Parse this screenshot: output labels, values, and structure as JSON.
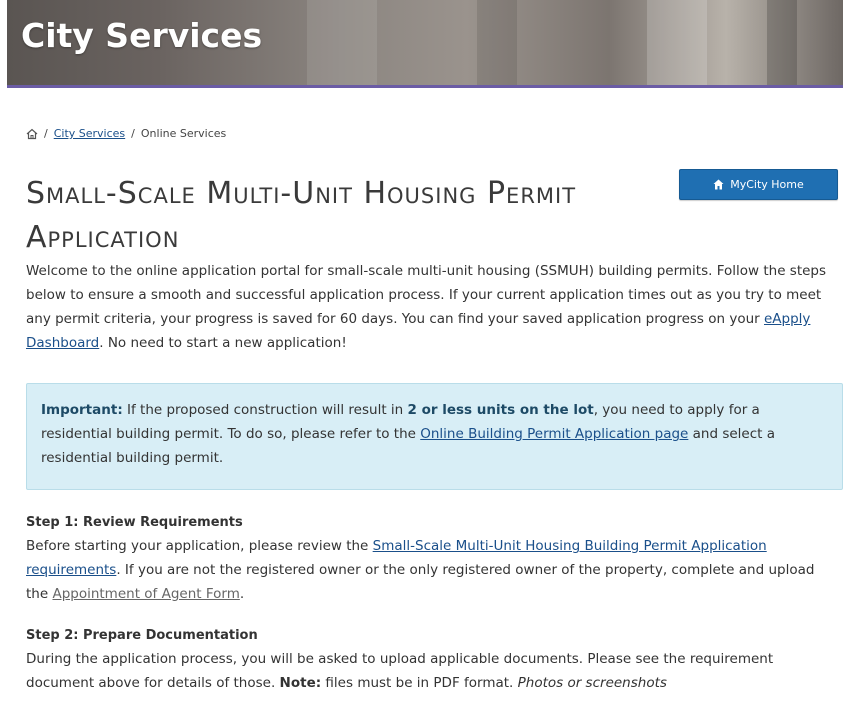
{
  "banner": {
    "title": "City Services"
  },
  "breadcrumb": {
    "crumb1": "City Services",
    "current": "Online Services",
    "sep": "/"
  },
  "header": {
    "title": "Small-Scale Multi-Unit Housing Permit Application",
    "mycity_button": "MyCity Home"
  },
  "intro": {
    "text_before_link": "Welcome to the online application portal for small-scale multi-unit housing (SSMUH) building permits. Follow the steps below to ensure a smooth and successful application process. If your current application times out as you try to meet any permit criteria, your progress is saved for 60 days. You can find your saved application progress on your ",
    "link": "eApply Dashboard",
    "text_after_link": ". No need to start a new application!"
  },
  "alert": {
    "label": "Important:",
    "text1": " If the proposed construction will result in ",
    "bold": "2 or less units on the lot",
    "text2": ", you need to apply for a residential building permit. To do so, please refer to the ",
    "link": "Online Building Permit Application page",
    "text3": " and select a residential building permit."
  },
  "step1": {
    "title": "Step 1: Review Requirements",
    "text1": "Before starting your application, please review the ",
    "link": "Small-Scale Multi-Unit Housing Building Permit Application requirements",
    "text2": ". If you are not the registered owner or the only registered owner of the property, complete and upload the ",
    "link2": "Appointment of Agent Form",
    "text3": "."
  },
  "step2": {
    "title": "Step 2: Prepare Documentation",
    "text1": "During the application process, you will be asked to upload applicable documents. Please see the requirement document above for details of those. ",
    "note_label": "Note:",
    "text2": " files must be in PDF format. ",
    "italic": "Photos or screenshots"
  },
  "colors": {
    "accent": "#1f6fb2",
    "alert_bg": "#d8eef6",
    "banner_border": "#6b5ca5",
    "link": "#1a4f8a"
  },
  "icons": {
    "home": "home-icon",
    "mycity": "house-icon"
  }
}
